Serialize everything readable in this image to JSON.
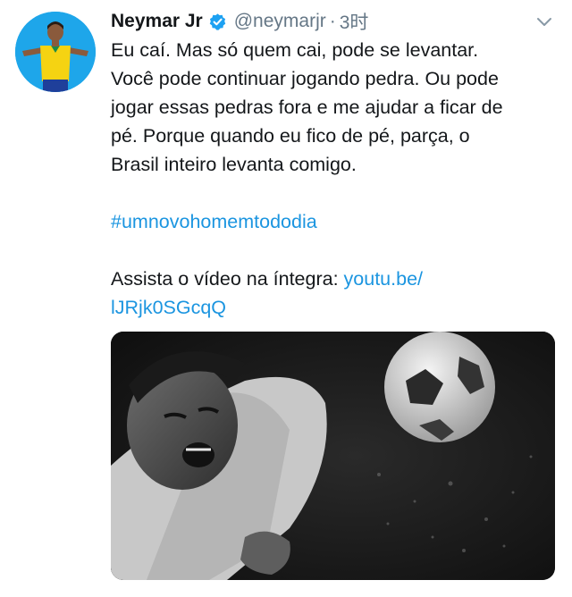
{
  "tweet": {
    "author_name": "Neymar Jr",
    "handle": "@neymarjr",
    "separator": "·",
    "time": "3时",
    "text_lines": [
      "Eu caí. Mas só quem cai, pode se levantar.",
      "Você pode continuar jogando pedra. Ou pode",
      "jogar essas pedras fora e me ajudar a ficar de",
      "pé. Porque quando eu fico de pé, parça, o",
      "Brasil inteiro levanta comigo."
    ],
    "hashtag": "#umnovohomemtododia",
    "link_prefix": "Assista o vídeo na íntegra: ",
    "link_line1": "youtu.be/",
    "link_line2": "lJRjk0SGcqQ"
  },
  "icons": {
    "verified": "verified-badge-icon",
    "menu": "chevron-down-icon"
  },
  "colors": {
    "link": "#1b95e0",
    "verified": "#1da1f2",
    "secondary_text": "#657786",
    "avatar_background": "#1ea6ea",
    "jersey": "#f5d312"
  }
}
